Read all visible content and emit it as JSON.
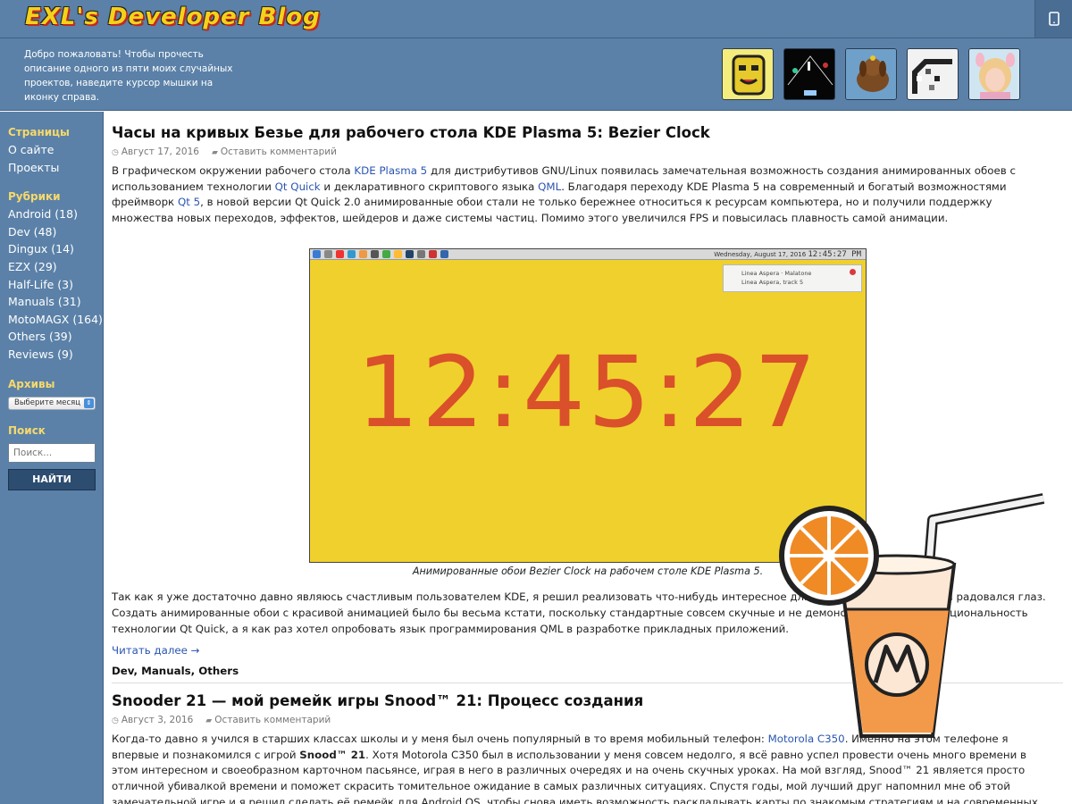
{
  "header": {
    "logo_text": "EXL's Developer Blog",
    "welcome": "Добро пожаловать! Чтобы прочесть описание одного из пяти моих случайных проектов, наведите курсор мышки на иконку справа.",
    "mobile_icon": "mobile-device-icon",
    "thumbnails": [
      "yellow-mask-thumbnail",
      "space-game-thumbnail",
      "dog-thumbnail",
      "pixel-art-thumbnail",
      "girl-avatar-thumbnail"
    ]
  },
  "sidebar": {
    "pages_heading": "Страницы",
    "pages": [
      "О сайте",
      "Проекты"
    ],
    "categories_heading": "Рубрики",
    "categories": [
      "Android (18)",
      "Dev (48)",
      "Dingux (14)",
      "EZX (29)",
      "Half-Life (3)",
      "Manuals (31)",
      "MotoMAGX (164)",
      "Others (39)",
      "Reviews (9)"
    ],
    "archives_heading": "Архивы",
    "archives_select": "Выберите месяц",
    "search_heading": "Поиск",
    "search_placeholder": "Поиск...",
    "search_button": "НАЙТИ"
  },
  "post1": {
    "title": "Часы на кривых Безье для рабочего стола KDE Plasma 5: Bezier Clock",
    "date": "Август 17, 2016",
    "comment": "Оставить комментарий",
    "p1": {
      "t1": "В графическом окружении рабочего стола ",
      "l1": "KDE Plasma 5",
      "t2": " для дистрибутивов GNU/Linux появилась замечательная возможность создания анимированных обоев с использованием технологии ",
      "l2": "Qt Quick",
      "t3": " и декларативного скриптового языка ",
      "l3": "QML",
      "t4": ". Благодаря переходу KDE Plasma 5 на современный и богатый возможностями фреймворк ",
      "l4": "Qt 5",
      "t5": ", в новой версии Qt Quick 2.0 анимированные обои стали не только бережнее относиться к ресурсам компьютера, но и получили поддержку множества новых переходов, эффектов, шейдеров и даже системы частиц. Помимо этого увеличился FPS и повысилась плавность самой анимации."
    },
    "screenshot": {
      "clock_text": "12:45:27",
      "taskbar_date": "Wednesday, August 17, 2016",
      "taskbar_time": "12:45:27 PM",
      "notif_line1": "Linea Aspera · Malatone",
      "notif_line2": "Linea Aspera, track 5"
    },
    "caption": "Анимированные обои Bezier Clock на рабочем столе KDE Plasma 5.",
    "p2": "Так как я уже достаточно давно являюсь счастливым пользователем KDE, я решил реализовать что-нибудь интересное для этого окружения, что бы радовался глаз. Создать анимированные обои с красивой анимацией было бы весьма кстати, поскольку стандартные совсем скучные и не демонстрируют всю функциональность технологии Qt Quick, а я как раз хотел опробовать язык программирования QML в разработке прикладных приложений.",
    "read_more": "Читать далее →",
    "categories": "Dev, Manuals, Others"
  },
  "post2": {
    "title": "Snooder 21 — мой ремейк игры Snood™ 21: Процесс создания",
    "date": "Август 3, 2016",
    "comment": "Оставить комментарий",
    "p1": {
      "t1": "Когда-то давно я учился в старших классах школы и у меня был очень популярный в то время мобильный телефон: ",
      "l1": "Motorola C350",
      "t2": ". Именно на этом телефоне я впервые и познакомился с игрой ",
      "b1": "Snood™ 21",
      "t3": ". Хотя Motorola C350 был в использовании у меня совсем недолго, я всё равно успел провести очень много времени в этом интересном и своеобразном карточном пасьянсе, играя в него в различных очередях и на очень скучных уроках. На мой взгляд, Snood™ 21 является просто отличной убивалкой времени и поможет скрасить томительное ожидание в самых различных ситуациях. Спустя годы, мой лучший друг напомнил мне об этой замечательной игре и я решил сделать её ремейк для Android OS, чтобы снова иметь возможность раскладывать карты по знакомым стратегиям и на современных смартфонах."
    }
  },
  "overlay": {
    "icon": "motorola-juice-glass-icon"
  },
  "colors": {
    "header_bg": "#5b81a8",
    "link": "#2a55b0",
    "sidebar_heading": "#f6d96b",
    "clock_digits": "#d9502a",
    "screen_bg": "#f0d02c"
  }
}
